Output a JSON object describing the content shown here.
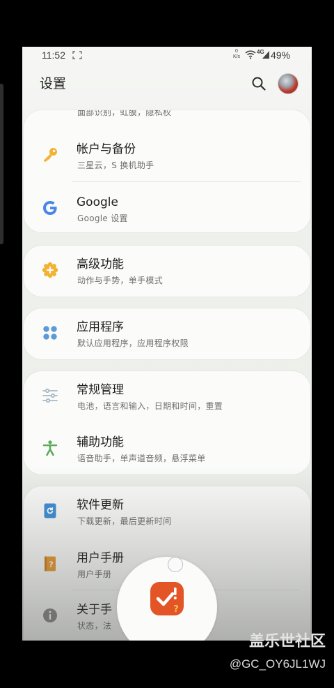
{
  "status_bar": {
    "time": "11:52",
    "net_speed_value": "0",
    "net_speed_unit": "K/s",
    "network": "4G",
    "battery": "49%",
    "icons": [
      "screenshot-frame-icon",
      "wifi-icon",
      "signal-icon"
    ]
  },
  "header": {
    "title": "设置",
    "search_icon": "search-icon",
    "avatar_icon": "avatar"
  },
  "cards": [
    {
      "partial_subtitle": "面部识别，虹膜，隐私权",
      "items": [
        {
          "icon": "key-icon",
          "title": "帐户与备份",
          "subtitle": "三星云，S 换机助手"
        },
        {
          "icon": "google-g-icon",
          "title": "Google",
          "subtitle": "Google 设置"
        }
      ]
    },
    {
      "items": [
        {
          "icon": "advanced-features-icon",
          "title": "高级功能",
          "subtitle": "动作与手势，单手模式"
        }
      ]
    },
    {
      "items": [
        {
          "icon": "apps-icon",
          "title": "应用程序",
          "subtitle": "默认应用程序，应用程序权限"
        }
      ]
    },
    {
      "items": [
        {
          "icon": "sliders-icon",
          "title": "常规管理",
          "subtitle": "电池，语言和输入，日期和时间，重置"
        },
        {
          "icon": "accessibility-icon",
          "title": "辅助功能",
          "subtitle": "语音助手，单声道音频，悬浮菜单"
        }
      ]
    },
    {
      "items": [
        {
          "icon": "software-update-icon",
          "title": "软件更新",
          "subtitle": "下载更新，最后更新时间"
        },
        {
          "icon": "user-manual-icon",
          "title": "用户手册",
          "subtitle": "用户手册"
        },
        {
          "icon": "info-icon",
          "title": "关于手",
          "subtitle": "状态，法"
        }
      ]
    }
  ],
  "floating_bubble": {
    "icon": "samsung-members-icon",
    "close_icon": "bubble-dismiss-icon"
  },
  "watermark": {
    "title": "盖乐世社区",
    "handle": "@GC_OY6JL1WJ"
  },
  "colors": {
    "key": "#f2b233",
    "google": "#4a86e8",
    "advanced": "#f2b233",
    "apps": "#5e9ad6",
    "sliders": "#a9b8c4",
    "accessibility": "#5aab5a",
    "update": "#3f8fd8",
    "manual": "#e89b33",
    "info": "#8a8a8a",
    "bubble_app": "#e35527"
  }
}
